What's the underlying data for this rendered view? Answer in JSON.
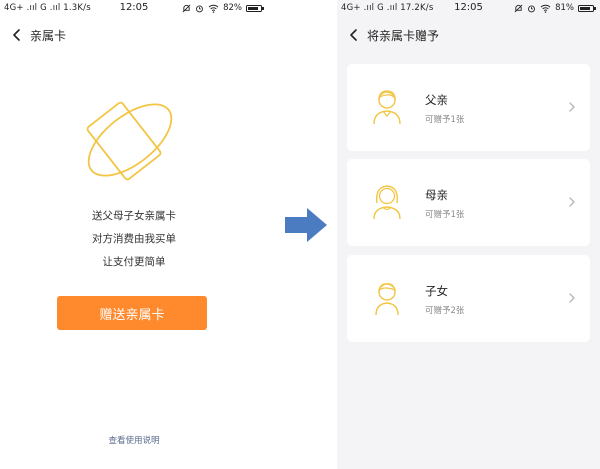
{
  "left": {
    "status": {
      "network": "4G+ .ııl G .ııl 1.3K/s",
      "time": "12:05",
      "battery": "82%",
      "battery_level": 0.82
    },
    "title": "亲属卡",
    "description": [
      "送父母子女亲属卡",
      "对方消费由我买单",
      "让支付更简单"
    ],
    "gift_button": "赠送亲属卡",
    "help_link": "查看使用说明",
    "accent_color": "#ff8a2e",
    "icons": {
      "back": "chevron-left-icon",
      "hero": "card-orbit-icon"
    }
  },
  "right": {
    "status": {
      "network": "4G+ .ııl G .ııl 17.2K/s",
      "time": "12:05",
      "battery": "81%",
      "battery_level": 0.81
    },
    "title": "将亲属卡赠予",
    "cards": [
      {
        "title": "父亲",
        "subtitle": "可赠予1张",
        "icon": "father-icon"
      },
      {
        "title": "母亲",
        "subtitle": "可赠予1张",
        "icon": "mother-icon"
      },
      {
        "title": "子女",
        "subtitle": "可赠予2张",
        "icon": "child-icon"
      }
    ]
  },
  "divider_arrow_color": "#4b7bc0"
}
